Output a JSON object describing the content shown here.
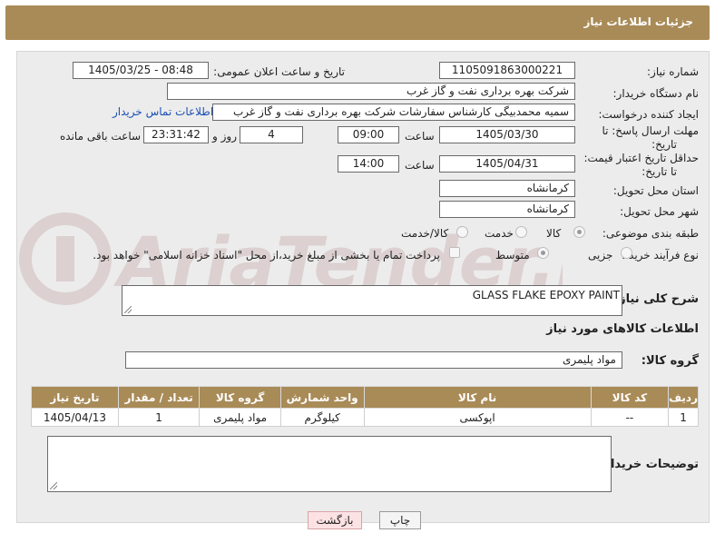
{
  "header": {
    "title": "جزئیات اطلاعات نیاز"
  },
  "fields": {
    "need_number_label": "شماره نیاز:",
    "need_number": "1105091863000221",
    "announce_label": "تاریخ و ساعت اعلان عمومی:",
    "announce_value": "1405/03/25 - 08:48",
    "buyer_org_label": "نام دستگاه خریدار:",
    "buyer_org": "شرکت بهره برداری نفت و گاز غرب",
    "creator_label": "ایجاد کننده درخواست:",
    "creator": "سمیه محمدبیگی کارشناس سفارشات شرکت بهره برداری نفت و گاز غرب",
    "contact_link": "اطلاعات تماس خریدار",
    "deadline_label_1": "مهلت ارسال پاسخ: تا",
    "deadline_label_2": "تاریخ:",
    "deadline_date": "1405/03/30",
    "time_label": "ساعت",
    "deadline_time": "09:00",
    "days_value": "4",
    "days_label": "روز و",
    "remaining_value": "23:31:42",
    "remaining_label": "ساعت باقی مانده",
    "min_price_label_1": "حداقل تاریخ اعتبار قیمت:",
    "min_price_label_2": "تا تاریخ:",
    "min_price_date": "1405/04/31",
    "min_price_time": "14:00",
    "province_label": "استان محل تحویل:",
    "province": "کرمانشاه",
    "city_label": "شهر محل تحویل:",
    "city": "کرمانشاه",
    "category_label": "طبقه بندی موضوعی:",
    "category_options": [
      "کالا",
      "خدمت",
      "کالا/خدمت"
    ],
    "process_label": "نوع فرآیند خرید :",
    "process_options": [
      "جزیی",
      "متوسط"
    ],
    "treasury_note": "پرداخت تمام یا بخشی از مبلغ خرید،از محل \"اسناد خزانه اسلامی\" خواهد بود.",
    "description_label": "شرح کلی نیاز:",
    "description": "GLASS FLAKE EPOXY PAINT",
    "goods_info_title": "اطلاعات کالاهای مورد نیاز",
    "goods_group_label": "گروه کالا:",
    "goods_group": "مواد پلیمری",
    "buyer_notes_label": "توضیحات خریدار:"
  },
  "table": {
    "headers": [
      "ردیف",
      "کد کالا",
      "نام کالا",
      "واحد شمارش",
      "گروه کالا",
      "تعداد / مقدار",
      "تاریخ نیاز"
    ],
    "rows": [
      [
        "1",
        "--",
        "اپوکسی",
        "کیلوگرم",
        "مواد پلیمری",
        "1",
        "1405/04/13"
      ]
    ]
  },
  "buttons": {
    "print": "چاپ",
    "back": "بازگشت"
  },
  "watermark": "AriaTender.net",
  "colors": {
    "header_bg": "#a98b58",
    "link": "#1a4fb4",
    "back_button": "#fde2e4"
  }
}
